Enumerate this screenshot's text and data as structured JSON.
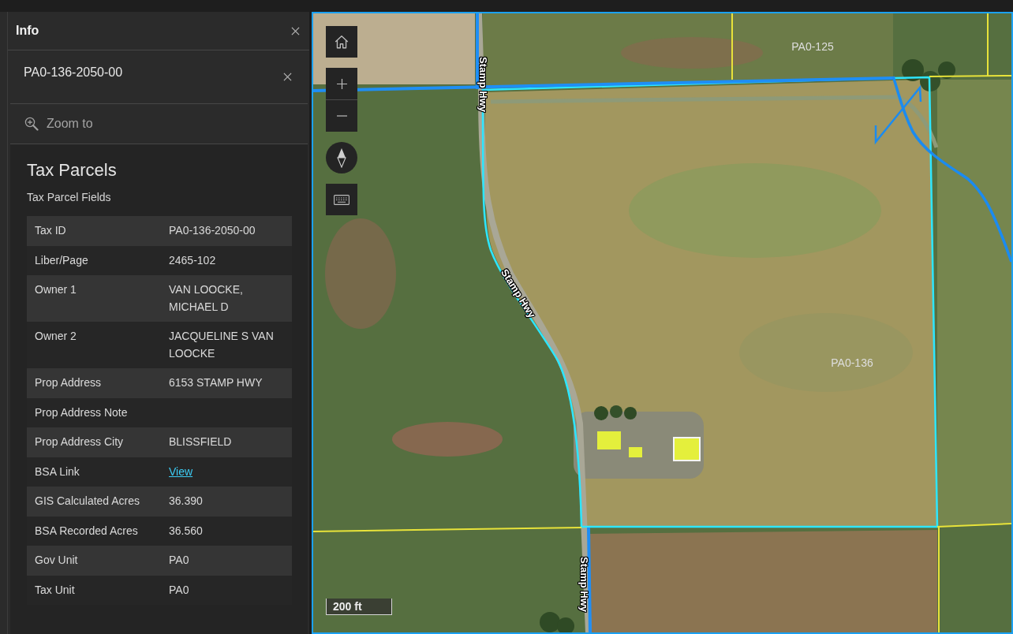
{
  "panel": {
    "title": "Info"
  },
  "feature": {
    "title": "PA0-136-2050-00",
    "zoom_action": "Zoom to"
  },
  "layer": {
    "title": "Tax Parcels",
    "subtitle": "Tax Parcel Fields"
  },
  "fields": [
    {
      "name": "Tax ID",
      "value": "PA0-136-2050-00",
      "kind": "text"
    },
    {
      "name": "Liber/Page",
      "value": "2465-102",
      "kind": "text"
    },
    {
      "name": "Owner 1",
      "value": "VAN LOOCKE, MICHAEL D",
      "kind": "text"
    },
    {
      "name": "Owner 2",
      "value": "JACQUELINE S VAN LOOCKE",
      "kind": "text"
    },
    {
      "name": "Prop Address",
      "value": "6153 STAMP HWY",
      "kind": "text"
    },
    {
      "name": "Prop Address Note",
      "kind": "text"
    },
    {
      "name": "Prop Address City",
      "value": "BLISSFIELD",
      "kind": "text"
    },
    {
      "name": "BSA Link",
      "value": "View",
      "kind": "link"
    },
    {
      "name": "GIS Calculated Acres",
      "value": "36.390",
      "kind": "text"
    },
    {
      "name": "BSA Recorded Acres",
      "value": "36.560",
      "kind": "text"
    },
    {
      "name": "Gov Unit",
      "value": "PA0",
      "kind": "text"
    },
    {
      "name": "Tax Unit",
      "value": "PA0",
      "kind": "text"
    }
  ],
  "map": {
    "labels": [
      {
        "text": "PA0-125",
        "kind": "parcel"
      },
      {
        "text": "Stamp Hwy",
        "kind": "road"
      },
      {
        "text": "Stamp Hwy",
        "kind": "road"
      },
      {
        "text": "PA0-136",
        "kind": "parcel"
      },
      {
        "text": "Stamp Hwy",
        "kind": "road"
      }
    ],
    "scale": "200 ft"
  }
}
